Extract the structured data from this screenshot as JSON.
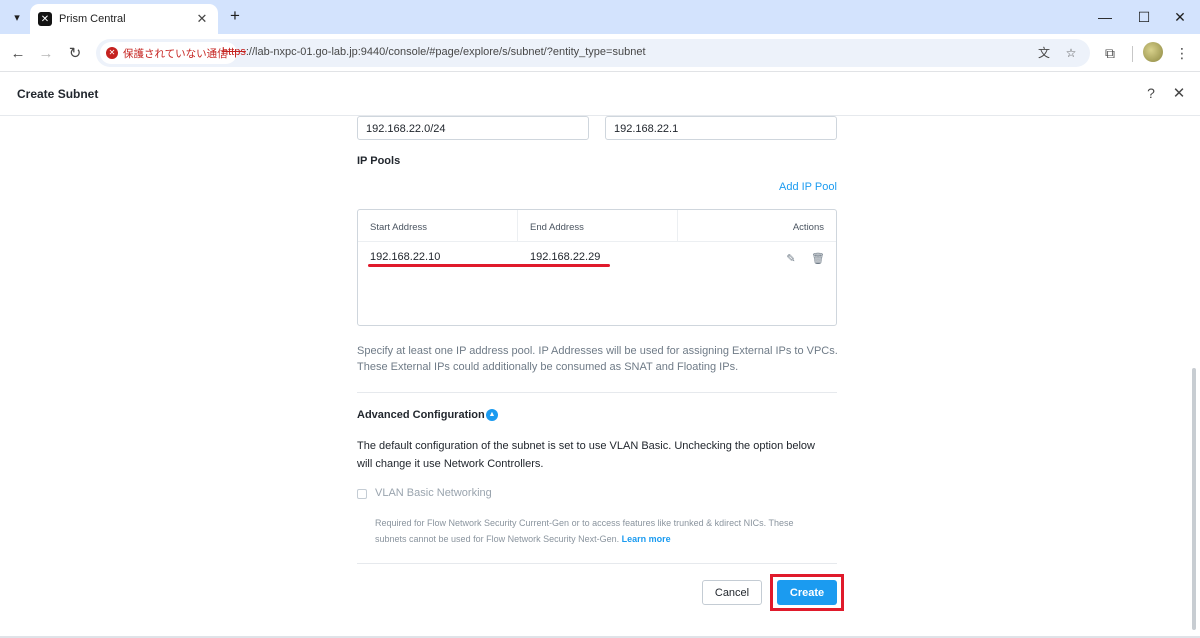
{
  "browser": {
    "tab_title": "Prism Central",
    "tab_close": "✕",
    "new_tab": "+",
    "security_label": "保護されていない通信",
    "url_scheme": "https",
    "url_rest": "://lab-nxpc-01.go-lab.jp:9440/console/#page/explore/s/subnet/?entity_type=subnet",
    "icons": {
      "tab_menu": "chevron-down-icon",
      "favicon": "prism-logo-icon",
      "back": "arrow-left-icon",
      "forward": "arrow-right-icon",
      "reload": "reload-icon",
      "translate": "translate-icon",
      "bookmark": "star-icon",
      "extensions": "puzzle-icon",
      "menu": "kebab-menu-icon",
      "minimize": "minimize-icon",
      "maximize": "maximize-icon",
      "close": "close-icon"
    }
  },
  "modal": {
    "title": "Create Subnet",
    "network_ip_value": "192.168.22.0/24",
    "gateway_ip_value": "192.168.22.1",
    "ip_pools_label": "IP Pools",
    "add_ip_pool": "Add IP Pool",
    "table": {
      "headers": [
        "Start Address",
        "End Address",
        "Actions"
      ],
      "rows": [
        {
          "start": "192.168.22.10",
          "end": "192.168.22.29"
        }
      ]
    },
    "pool_help_line1": "Specify at least one IP address pool. IP Addresses will be used for assigning External IPs to VPCs.",
    "pool_help_line2": "These External IPs could additionally be consumed as SNAT and Floating IPs.",
    "advanced_title": "Advanced Configuration",
    "advanced_desc_line1": "The default configuration of the subnet is set to use VLAN Basic. Unchecking the option below",
    "advanced_desc_line2": "will change it use Network Controllers.",
    "vlan_checkbox_label": "VLAN Basic Networking",
    "vlan_checked": false,
    "fine_print_line1": "Required for Flow Network Security Current-Gen or to access features like trunked & kdirect NICs. These",
    "fine_print_line2": "subnets cannot be used for Flow Network Security Next-Gen.",
    "learn_more": "Learn more",
    "cancel_label": "Cancel",
    "create_label": "Create"
  },
  "colors": {
    "accent": "#1b9bf0",
    "annotation_red": "#e01a2b",
    "chrome_titlebar": "#d3e3fd",
    "insecure_red": "#c5221f"
  }
}
